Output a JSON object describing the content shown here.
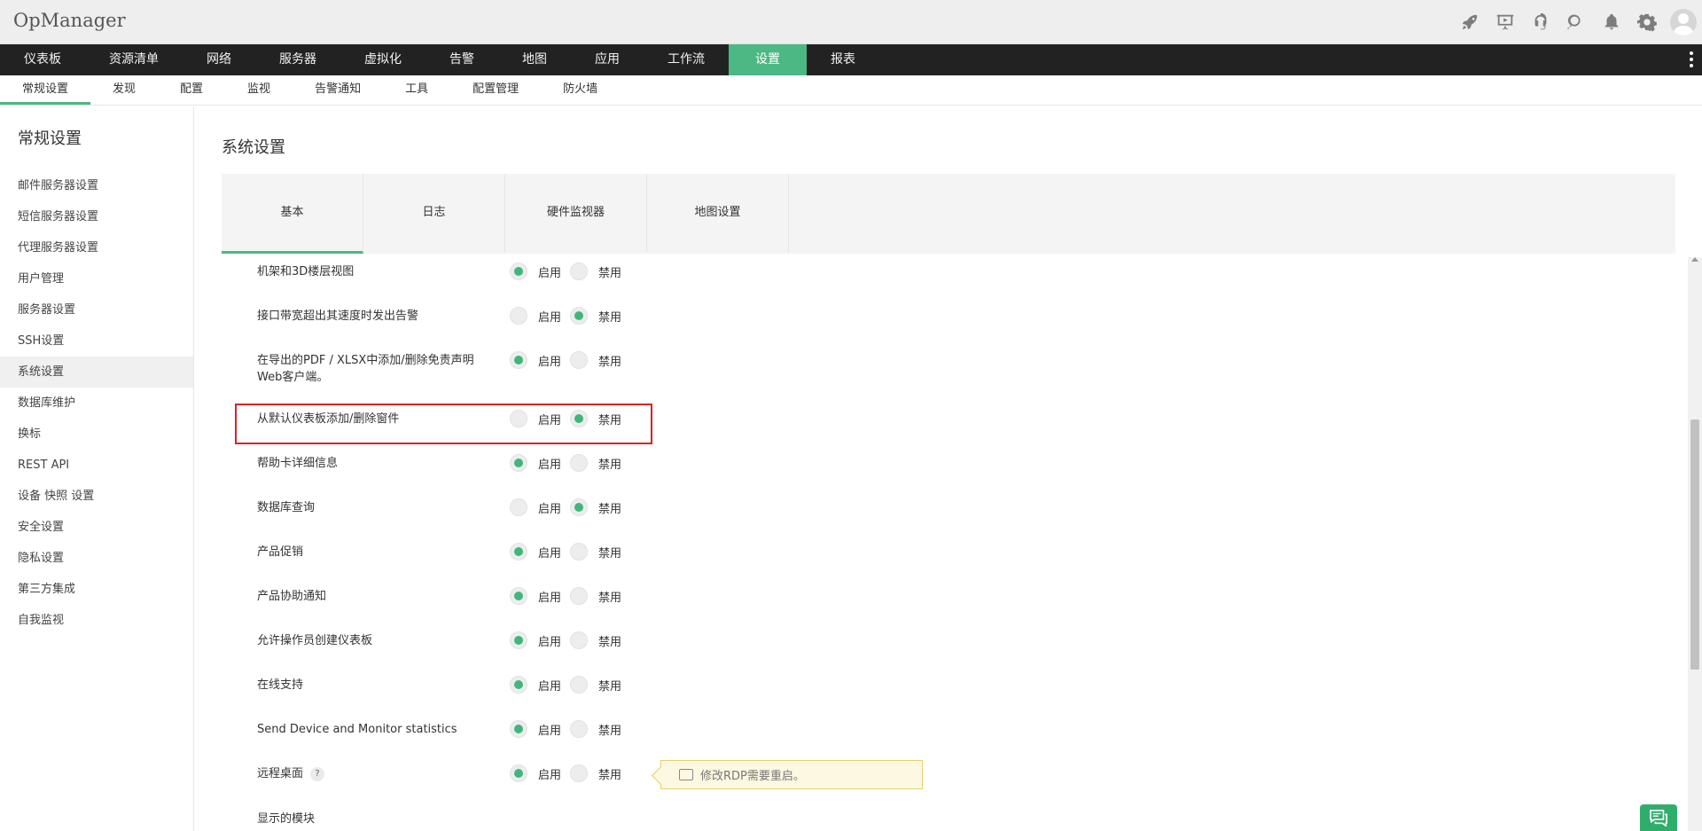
{
  "app": {
    "title": "OpManager"
  },
  "header_icons": [
    "rocket-icon",
    "presentation-icon",
    "headset-icon",
    "search-icon",
    "bell-icon",
    "gear-icon",
    "user-avatar-icon"
  ],
  "main_nav": [
    "仪表板",
    "资源清单",
    "网络",
    "服务器",
    "虚拟化",
    "告警",
    "地图",
    "应用",
    "工作流",
    "设置",
    "报表"
  ],
  "main_nav_active": "设置",
  "sub_nav": [
    "常规设置",
    "发现",
    "配置",
    "监视",
    "告警通知",
    "工具",
    "配置管理",
    "防火墙"
  ],
  "sub_nav_active": "常规设置",
  "sidebar": {
    "title": "常规设置",
    "items": [
      "邮件服务器设置",
      "短信服务器设置",
      "代理服务器设置",
      "用户管理",
      "服务器设置",
      "SSH设置",
      "系统设置",
      "数据库维护",
      "换标",
      "REST API",
      "设备 快照 设置",
      "安全设置",
      "隐私设置",
      "第三方集成",
      "自我监视"
    ],
    "active": "系统设置"
  },
  "page": {
    "title": "系统设置",
    "tabs": [
      "基本",
      "日志",
      "硬件监视器",
      "地图设置"
    ],
    "active_tab": "基本"
  },
  "options": {
    "enable": "启用",
    "disable": "禁用"
  },
  "settings": [
    {
      "label": "机架和3D楼层视图",
      "enabled": true
    },
    {
      "label": "接口带宽超出其速度时发出告警",
      "enabled": false
    },
    {
      "label": "在导出的PDF / XLSX中添加/删除免责声明",
      "label2": "Web客户端。",
      "enabled": true
    },
    {
      "label": "从默认仪表板添加/删除窗件",
      "enabled": false,
      "highlighted": true
    },
    {
      "label": "帮助卡详细信息",
      "enabled": true
    },
    {
      "label": "数据库查询",
      "enabled": false
    },
    {
      "label": "产品促销",
      "enabled": true
    },
    {
      "label": "产品协助通知",
      "enabled": true
    },
    {
      "label": "允许操作员创建仪表板",
      "enabled": true
    },
    {
      "label": "在线支持",
      "enabled": true
    },
    {
      "label": "Send Device and Monitor statistics",
      "enabled": true
    },
    {
      "label": "远程桌面",
      "enabled": true,
      "help": "?"
    },
    {
      "label": "显示的模块"
    }
  ],
  "tooltip": {
    "text": "修改RDP需要重启。"
  },
  "colors": {
    "accent": "#4cb883",
    "nav_bg": "#222222",
    "highlight": "#e02020"
  }
}
